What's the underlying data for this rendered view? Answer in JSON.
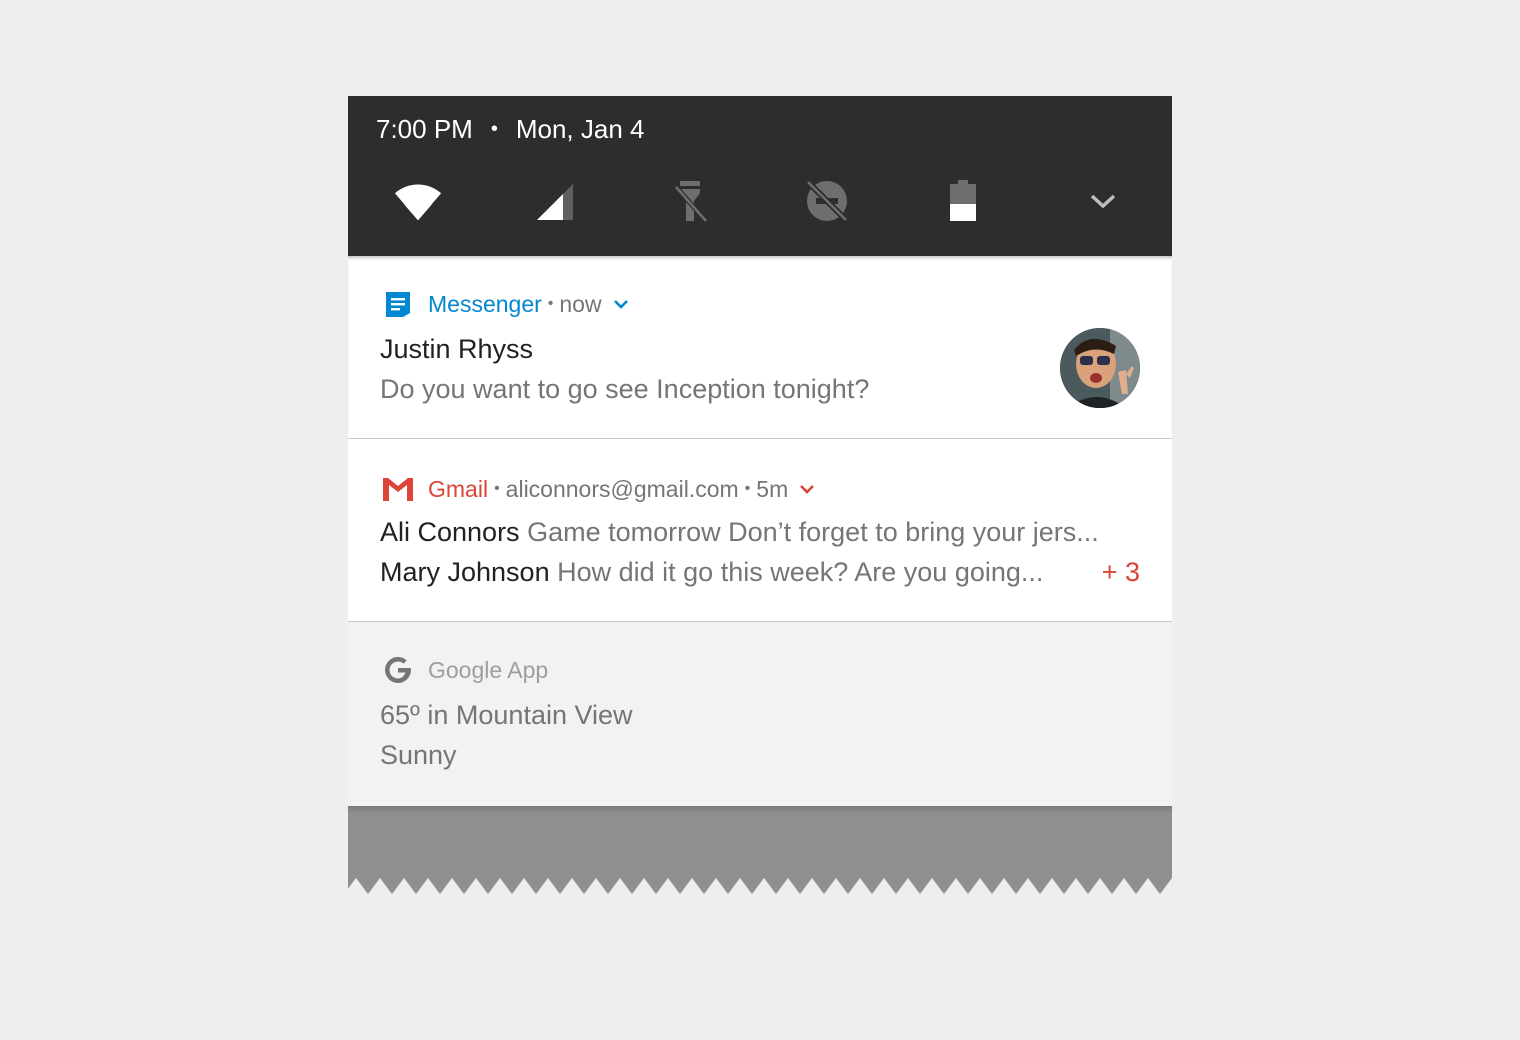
{
  "status": {
    "time": "7:00 PM",
    "separator": "•",
    "date": "Mon, Jan 4"
  },
  "quick_settings": [
    {
      "icon": "wifi-icon"
    },
    {
      "icon": "cell-signal-icon"
    },
    {
      "icon": "flashlight-off-icon"
    },
    {
      "icon": "do-not-disturb-off-icon"
    },
    {
      "icon": "battery-half-icon"
    },
    {
      "icon": "expand-chevron-icon"
    }
  ],
  "notifications": {
    "messenger": {
      "app": "Messenger",
      "sep": "•",
      "time": "now",
      "accent": "#0288d1",
      "title": "Justin Rhyss",
      "text": "Do you want to go see Inception tonight?"
    },
    "gmail": {
      "app": "Gmail",
      "sep1": "•",
      "account": "aliconnors@gmail.com",
      "sep2": "•",
      "time": "5m",
      "accent": "#db4437",
      "rows": [
        {
          "sender": "Ali Connors",
          "text": "Game tomorrow Don’t forget to bring your jers..."
        },
        {
          "sender": "Mary Johnson",
          "text": "How did it go this week? Are you going..."
        }
      ],
      "more": "+ 3"
    },
    "google": {
      "app": "Google App",
      "title": "65º in Mountain View",
      "text": "Sunny"
    }
  },
  "colors": {
    "header_bg": "#2d2d2d",
    "page_bg": "#eeeeee",
    "torn_bg": "#8f8f8f"
  }
}
